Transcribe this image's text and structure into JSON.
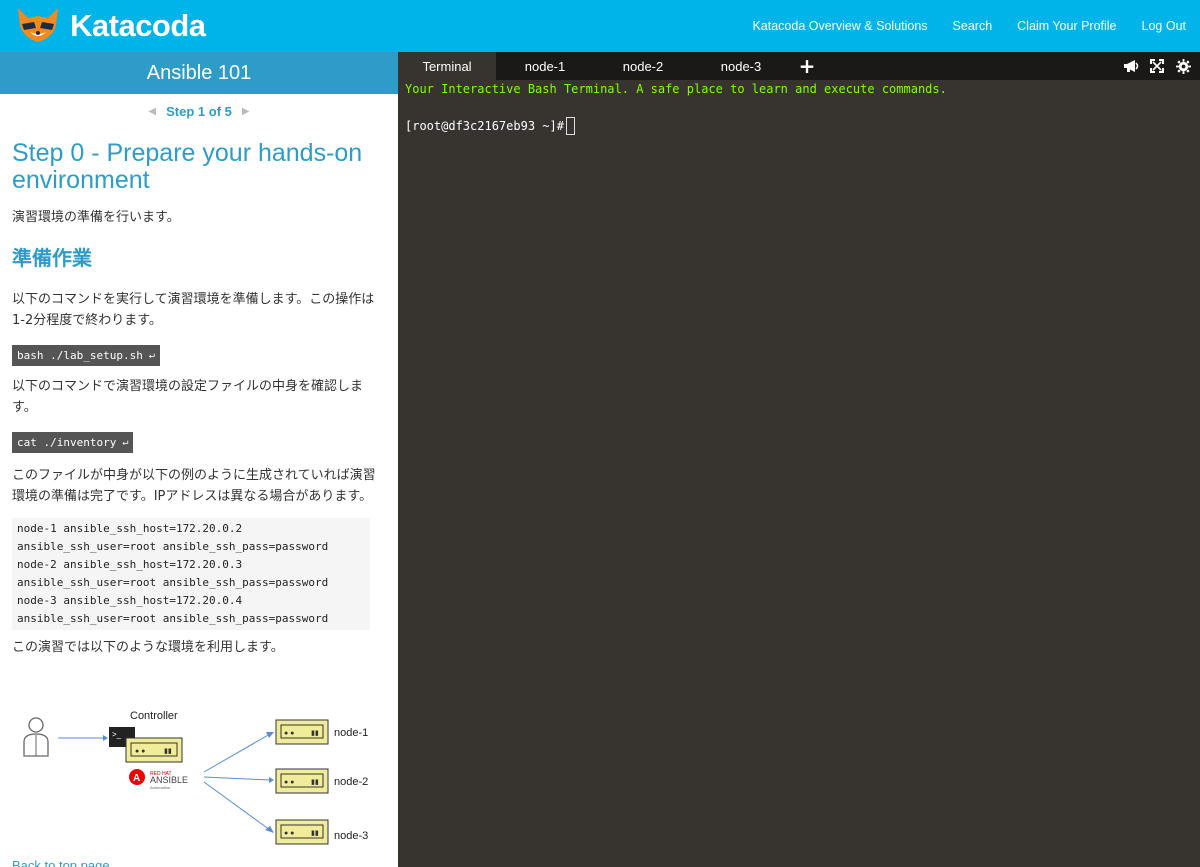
{
  "brand": {
    "name": "Katacoda",
    "accent": "#00b3e8",
    "panel_accent": "#2f9cc7"
  },
  "topnav": [
    "Katacoda Overview & Solutions",
    "Search",
    "Claim Your Profile",
    "Log Out"
  ],
  "course": {
    "title": "Ansible 101",
    "step_label": "Step 1 of 5"
  },
  "content": {
    "heading": "Step 0 - Prepare your hands-on environment",
    "intro": "演習環境の準備を行います。",
    "subheading": "準備作業",
    "para1": "以下のコマンドを実行して演習環境を準備します。この操作は1-2分程度で終わります。",
    "cmd1": "bash ./lab_setup.sh",
    "para2": "以下のコマンドで演習環境の設定ファイルの中身を確認します。",
    "cmd2": "cat ./inventory",
    "para3": "このファイルが中身が以下の例のように生成されていれば演習環境の準備は完了です。IPアドレスは異なる場合があります。",
    "code_lines": [
      "node-1 ansible_ssh_host=172.20.0.2",
      "ansible_ssh_user=root ansible_ssh_pass=password",
      "node-2 ansible_ssh_host=172.20.0.3",
      "ansible_ssh_user=root ansible_ssh_pass=password",
      "node-3 ansible_ssh_host=172.20.0.4",
      "ansible_ssh_user=root ansible_ssh_pass=password"
    ],
    "para4": "この演習では以下のような環境を利用します。",
    "back_link": "Back to top page"
  },
  "diagram": {
    "controller_label": "Controller",
    "redhat_line1": "RED HAT",
    "redhat_line2": "ANSIBLE",
    "redhat_line3": "Automation",
    "nodes": [
      "node-1",
      "node-2",
      "node-3"
    ]
  },
  "terminal": {
    "tabs": [
      "Terminal",
      "node-1",
      "node-2",
      "node-3"
    ],
    "add_tab": "+",
    "banner": "Your Interactive Bash Terminal. A safe place to learn and execute commands.",
    "prompt": "[root@df3c2167eb93 ~]#",
    "banner_color": "#7fff00",
    "background": "#37342f"
  },
  "icons": [
    "fox-logo-icon",
    "chevron-left-icon",
    "chevron-right-icon",
    "return-icon",
    "megaphone-icon",
    "expand-icon",
    "gear-icon"
  ]
}
